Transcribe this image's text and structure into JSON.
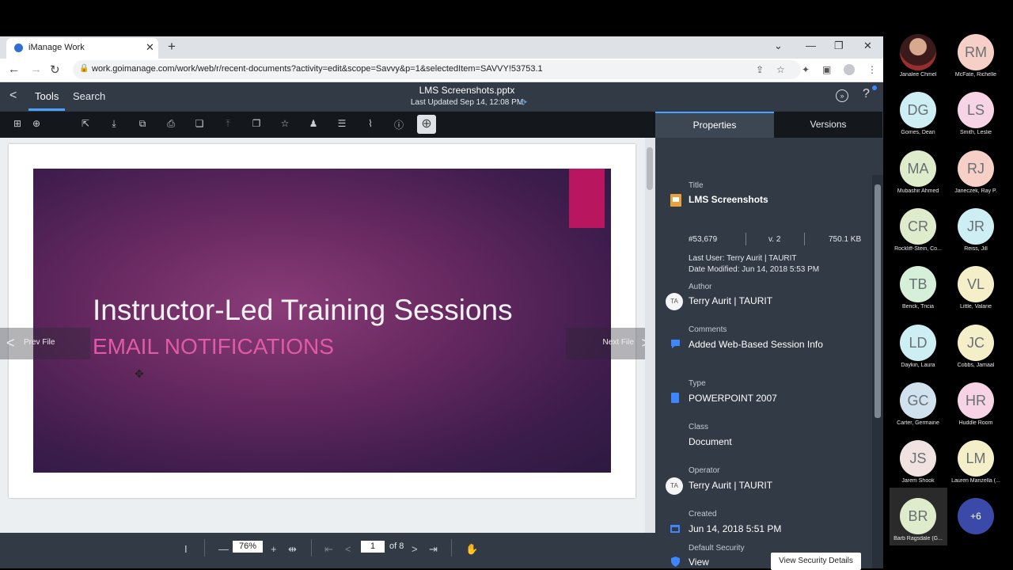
{
  "browser": {
    "tab_title": "iManage Work",
    "tab_close": "✕",
    "new_tab": "+",
    "url": "work.goimanage.com/work/web/r/recent-documents?activity=edit&scope=Savvy&p=1&selectedItem=SAVVY!53753.1",
    "icons": [
      "back-icon",
      "forward-icon",
      "reload-icon",
      "lock-icon",
      "share-icon",
      "star-icon",
      "extensions-icon",
      "sidepanel-icon",
      "profile-icon",
      "menu-icon"
    ]
  },
  "app": {
    "tabs": [
      "Tools",
      "Search"
    ],
    "doc_name": "LMS Screenshots.pptx",
    "last_updated": "Last Updated Sep 14, 12:08 PM"
  },
  "slide": {
    "title": "Instructor-Led Training Sessions",
    "subtitle": "EMAIL NOTIFICATIONS",
    "prev_file": "Prev File",
    "next_file": "Next File",
    "accent_color": "#b8175f"
  },
  "bottom": {
    "zoom": "76%",
    "page": "1",
    "of_pages": "of 8"
  },
  "panel": {
    "tabs": [
      "Properties",
      "Versions"
    ],
    "title_label": "Title",
    "title_value": "LMS Screenshots",
    "doc_number": "#53,679",
    "version": "v. 2",
    "size": "750.1 KB",
    "last_user": "Last User: Terry Aurit | TAURIT",
    "date_modified": "Date Modified: Jun 14, 2018 5:53 PM",
    "author_label": "Author",
    "author_initials": "TA",
    "author_value": "Terry Aurit | TAURIT",
    "comments_label": "Comments",
    "comments_value": "Added Web-Based Session Info",
    "type_label": "Type",
    "type_value": "POWERPOINT 2007",
    "class_label": "Class",
    "class_value": "Document",
    "operator_label": "Operator",
    "operator_initials": "TA",
    "operator_value": "Terry Aurit | TAURIT",
    "created_label": "Created",
    "created_value": "Jun 14, 2018 5:51 PM",
    "security_label": "Default Security",
    "security_value": "View",
    "security_button": "View Security Details"
  },
  "participants": [
    {
      "initials": "",
      "name": "Janalee Chmel",
      "color": "#7a3b3b",
      "photo": true
    },
    {
      "initials": "RM",
      "name": "McFate, Richelle",
      "color": "#f6d0c6"
    },
    {
      "initials": "DG",
      "name": "Gomes, Dean",
      "color": "#cdeef2"
    },
    {
      "initials": "LS",
      "name": "Smith, Leslie",
      "color": "#f7d3e6"
    },
    {
      "initials": "MA",
      "name": "Mubashir Ahmed",
      "color": "#dfeccb"
    },
    {
      "initials": "RJ",
      "name": "Janeczek, Ray P.",
      "color": "#f6d0c6"
    },
    {
      "initials": "CR",
      "name": "Rockliff-Stein, Co...",
      "color": "#dfeccb"
    },
    {
      "initials": "JR",
      "name": "Reiss, Jill",
      "color": "#cdeef2"
    },
    {
      "initials": "TB",
      "name": "Benck, Tricia",
      "color": "#d6efd9"
    },
    {
      "initials": "VL",
      "name": "Little, Valarie",
      "color": "#f4efc9"
    },
    {
      "initials": "LD",
      "name": "Daykin, Laura",
      "color": "#cdeef2"
    },
    {
      "initials": "JC",
      "name": "Cobbs, Jamaal",
      "color": "#f4efc9"
    },
    {
      "initials": "GC",
      "name": "Carter, Germaine",
      "color": "#d0e2ee"
    },
    {
      "initials": "HR",
      "name": "Huddle Room",
      "color": "#f7d3e6"
    },
    {
      "initials": "JS",
      "name": "Jarem Shook",
      "color": "#f1e2e2"
    },
    {
      "initials": "LM",
      "name": "Lauren Manzella (...",
      "color": "#f4efc9"
    },
    {
      "initials": "BR",
      "name": "Barb Ragsdale (G...",
      "color": "#dfeccb"
    },
    {
      "initials": "+6",
      "name": "",
      "color": "#3b4aa8"
    }
  ]
}
